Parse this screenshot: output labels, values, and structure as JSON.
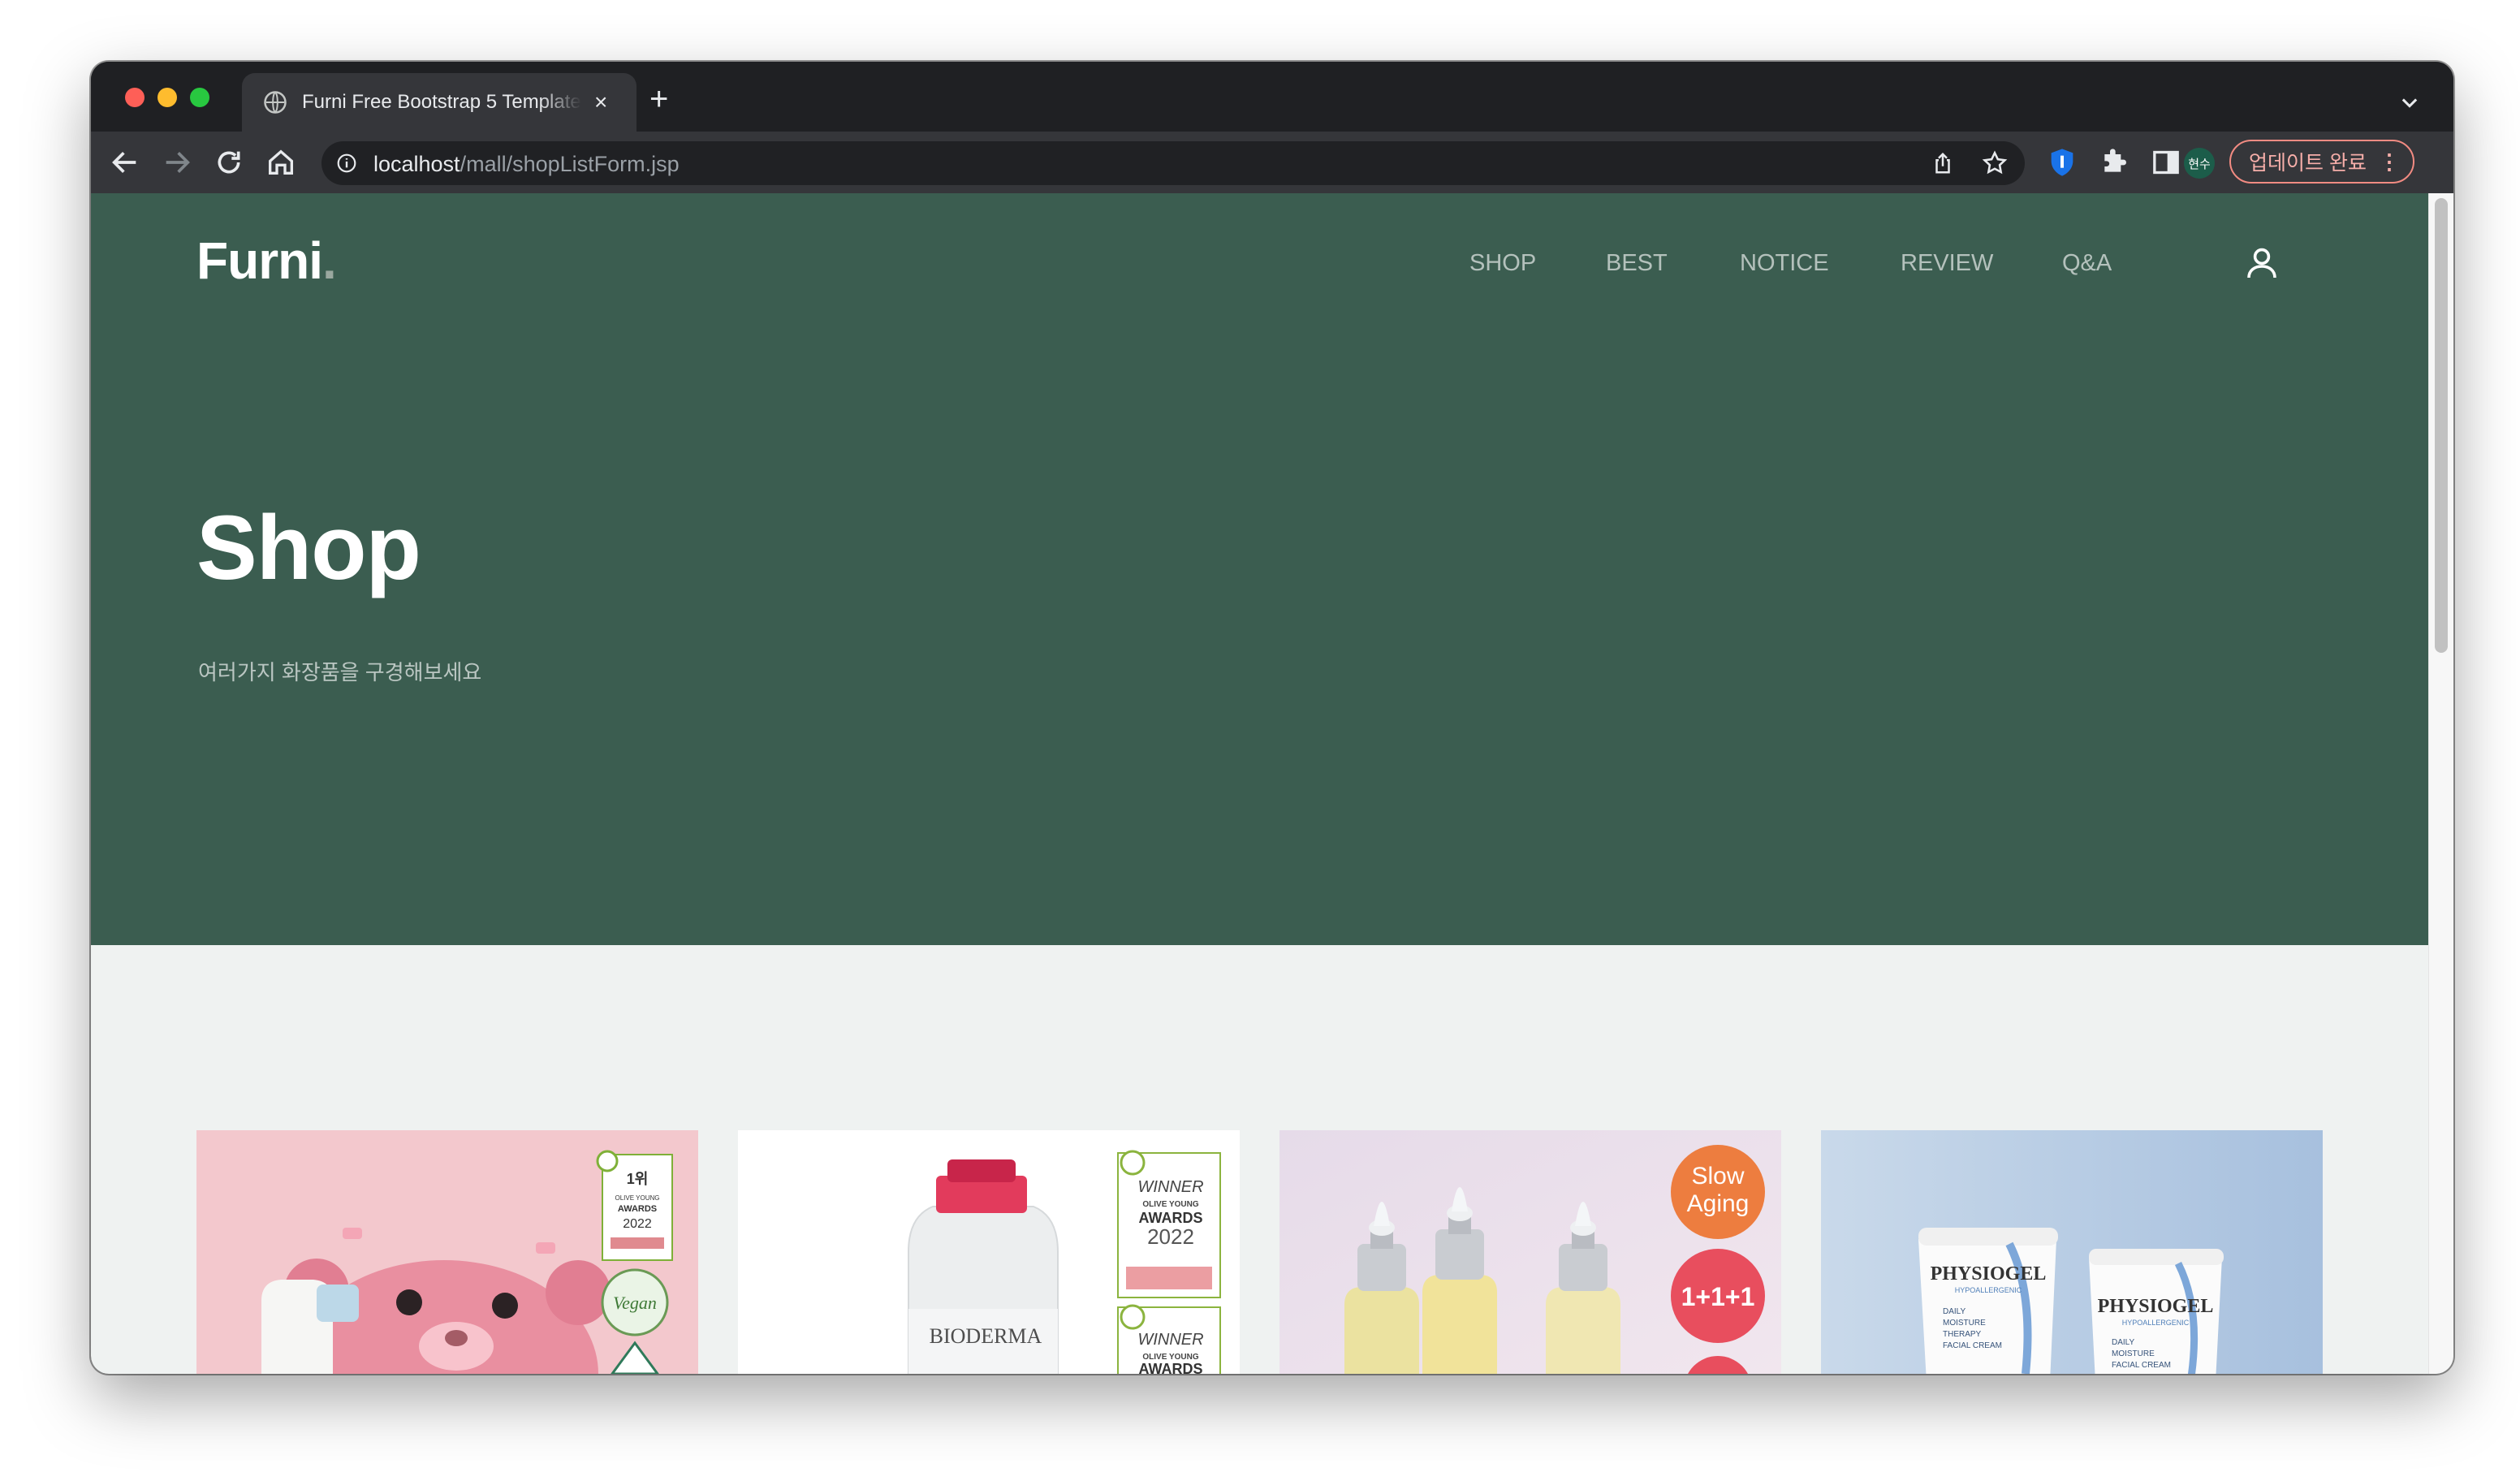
{
  "browser": {
    "tab_title": "Furni Free Bootstrap 5 Template",
    "url_host": "localhost",
    "url_path": "/mall/shopListForm.jsp",
    "profile_label": "현수",
    "update_label": "업데이트 완료"
  },
  "site": {
    "logo_text": "Furni",
    "logo_dot": ".",
    "nav": [
      "SHOP",
      "BEST",
      "NOTICE",
      "REVIEW",
      "Q&A"
    ]
  },
  "hero": {
    "title": "Shop",
    "subtitle": "여러가지 화장품을 구경해보세요"
  },
  "products": [
    {
      "badges": [
        "1위",
        "OLIVE YOUNG",
        "AWARDS",
        "2022",
        "Vegan"
      ]
    },
    {
      "brand": "BIODERMA",
      "badges": [
        "WINNER",
        "OLIVE YOUNG",
        "AWARDS",
        "2022",
        "WINNER",
        "OLIVE YOUNG",
        "AWARDS"
      ]
    },
    {
      "badges": [
        "Slow",
        "Aging",
        "1+1+1"
      ]
    },
    {
      "brand": "PHYSIOGEL",
      "lines": [
        "HYPOALLERGENIC",
        "DAILY",
        "MOISTURE",
        "THERAPY",
        "FACIAL CREAM"
      ]
    }
  ],
  "colors": {
    "hero_bg": "#3b5d50",
    "page_bg": "#eff2f1",
    "accent_update": "#f28b82"
  },
  "icons": [
    "globe-icon",
    "close-icon",
    "plus-icon",
    "chevron-down-icon",
    "back-icon",
    "forward-icon",
    "reload-icon",
    "home-icon",
    "info-icon",
    "share-icon",
    "star-icon",
    "shield-icon",
    "puzzle-icon",
    "sidepanel-icon",
    "user-icon"
  ]
}
